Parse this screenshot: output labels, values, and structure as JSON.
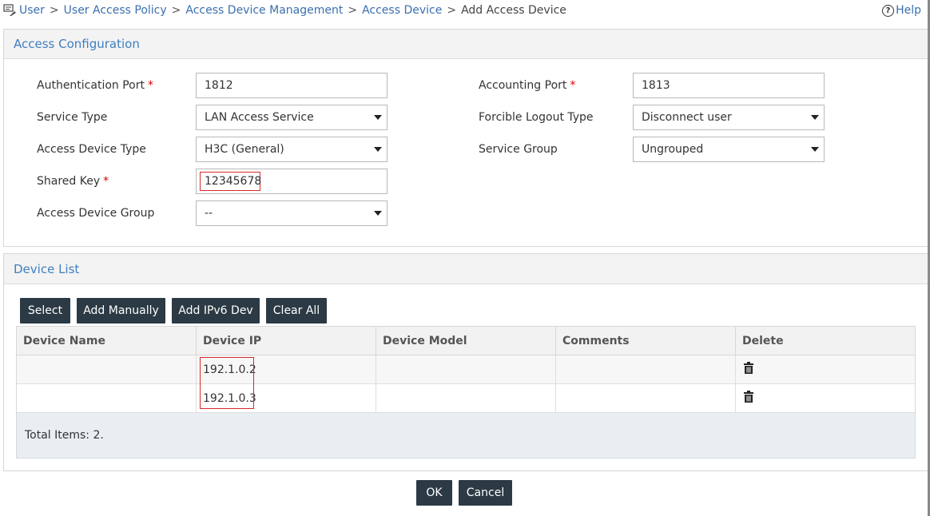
{
  "breadcrumb": {
    "items": [
      "User",
      "User Access Policy",
      "Access Device Management",
      "Access Device"
    ],
    "current": "Add Access Device",
    "separator": ">"
  },
  "help": {
    "label": "Help"
  },
  "access_config": {
    "title": "Access Configuration",
    "fields": {
      "authentication_port": {
        "label": "Authentication Port",
        "required_mark": "*",
        "value": "1812"
      },
      "accounting_port": {
        "label": "Accounting Port",
        "required_mark": "*",
        "value": "1813"
      },
      "service_type": {
        "label": "Service Type",
        "value": "LAN Access Service"
      },
      "forcible_logout_type": {
        "label": "Forcible Logout Type",
        "value": "Disconnect user"
      },
      "access_device_type": {
        "label": "Access Device Type",
        "value": "H3C (General)"
      },
      "service_group": {
        "label": "Service Group",
        "value": "Ungrouped"
      },
      "shared_key": {
        "label": "Shared Key",
        "required_mark": "*",
        "value": "12345678"
      },
      "access_device_group": {
        "label": "Access Device Group",
        "value": "--"
      }
    }
  },
  "device_list": {
    "title": "Device List",
    "buttons": {
      "select": "Select",
      "add_manually": "Add Manually",
      "add_ipv6": "Add IPv6 Dev",
      "clear_all": "Clear All"
    },
    "columns": [
      "Device Name",
      "Device IP",
      "Device Model",
      "Comments",
      "Delete"
    ],
    "rows": [
      {
        "name": "",
        "ip": "192.1.0.2",
        "model": "",
        "comments": ""
      },
      {
        "name": "",
        "ip": "192.1.0.3",
        "model": "",
        "comments": ""
      }
    ],
    "total": "Total Items: 2."
  },
  "footer": {
    "ok": "OK",
    "cancel": "Cancel"
  },
  "icons": {
    "breadcrumb": "user-policy-icon",
    "delete": "trash-icon",
    "help": "help-circle-icon"
  },
  "colors": {
    "link": "#3a6fb0",
    "panel_title": "#3f7fbf",
    "button_bg": "#2b3a44",
    "required": "#dd0000",
    "highlight_box": "#d42a2a"
  }
}
